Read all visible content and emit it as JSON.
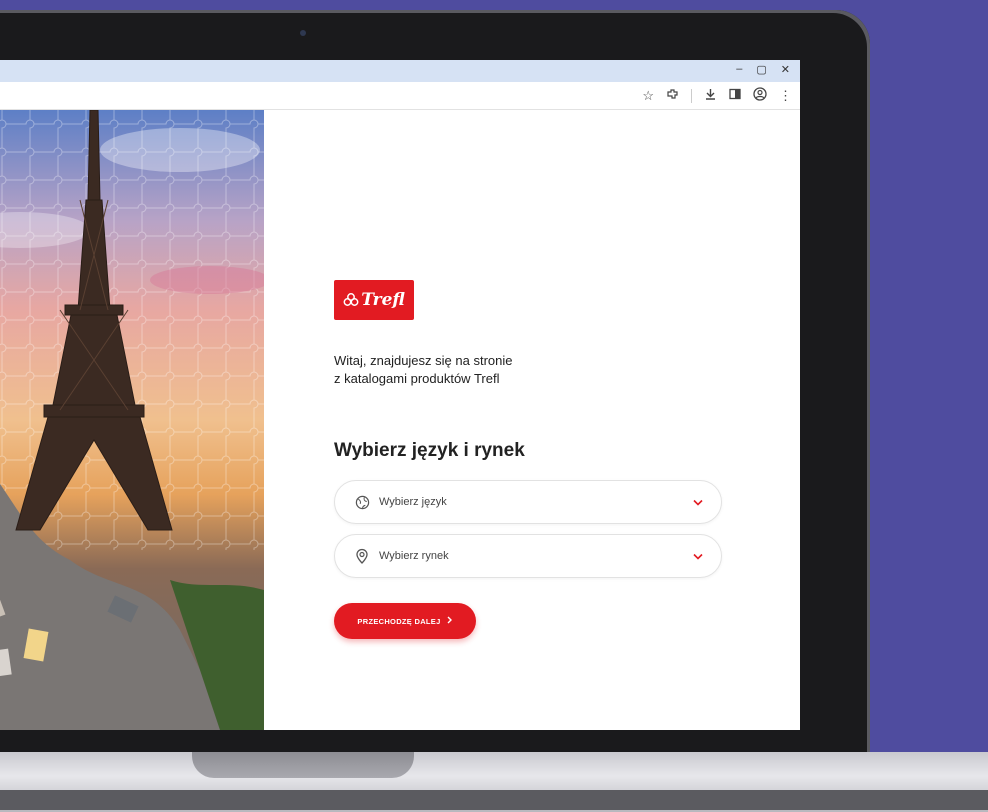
{
  "browser": {
    "window_controls": [
      "–",
      "▢",
      "✕"
    ],
    "toolbar_icons": [
      "star-icon",
      "extension-icon",
      "download-icon",
      "sidebar-icon",
      "profile-icon",
      "menu-icon"
    ]
  },
  "logo": {
    "text": "Trefl"
  },
  "intro": {
    "line1": "Witaj, znajdujesz się na stronie",
    "line2": "z katalogami produktów Trefl"
  },
  "heading": "Wybierz język i rynek",
  "language_select": {
    "label": "Wybierz język",
    "icon": "globe-icon"
  },
  "market_select": {
    "label": "Wybierz rynek",
    "icon": "location-pin-icon"
  },
  "continue_button": {
    "label": "PRZECHODZĘ DALEJ",
    "icon": "chevron-right-icon"
  },
  "colors": {
    "brand_red": "#e21b22",
    "background": "#4f4c9f",
    "titlebar": "#d6e2f4"
  }
}
